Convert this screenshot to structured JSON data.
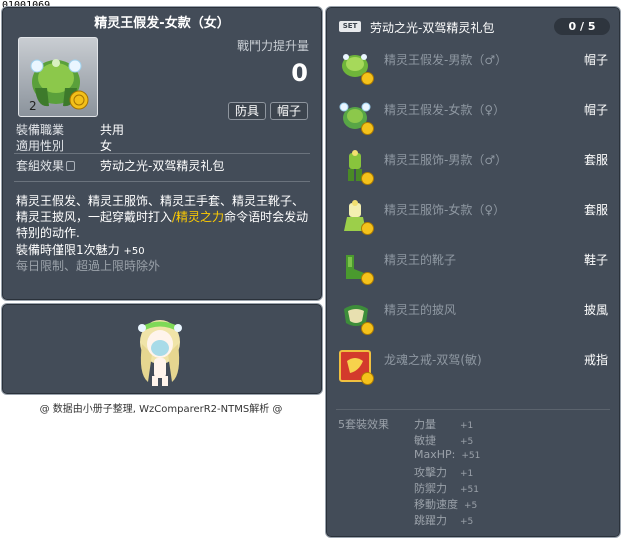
{
  "item_id": "01001069",
  "item": {
    "name": "精灵王假发-女款（女）",
    "power_label": "戰鬥力提升量",
    "power_value": "0",
    "tags": [
      "防具",
      "帽子"
    ],
    "stats": [
      {
        "key": "裝備職業",
        "value": "共用"
      },
      {
        "key": "適用性別",
        "value": "女"
      }
    ],
    "set_effect_label": "套組效果",
    "set_effect_value": "劳动之光-双驾精灵礼包",
    "desc_part1": "精灵王假发、精灵王服饰、精灵王手套、精灵王靴子、精灵王披风，一起穿戴时打入",
    "desc_highlight": "/精灵之力",
    "desc_part2": "命令语时会发动特别的动作.",
    "limit_label": "裝備時僅限1次魅力",
    "limit_value": "+50",
    "daily_note": "每日限制、超過上限時除外"
  },
  "credit": "@ 数据由小册子整理, WzComparerR2-NTMS解析 @",
  "set": {
    "badge": "SET",
    "name": "劳动之光-双驾精灵礼包",
    "count": "0 / 5",
    "items": [
      {
        "name": "精灵王假发-男款（♂）",
        "type": "帽子",
        "icon": "hat-icon",
        "color": "#6fb53a"
      },
      {
        "name": "精灵王假发-女款（♀）",
        "type": "帽子",
        "icon": "hat-icon",
        "color": "#58a646"
      },
      {
        "name": "精灵王服饰-男款（♂）",
        "type": "套服",
        "icon": "outfit-icon",
        "color": "#88c43c"
      },
      {
        "name": "精灵王服饰-女款（♀）",
        "type": "套服",
        "icon": "outfit-icon",
        "color": "#9ccf4a"
      },
      {
        "name": "精灵王的靴子",
        "type": "鞋子",
        "icon": "shoes-icon",
        "color": "#4a9a2e"
      },
      {
        "name": "精灵王的披风",
        "type": "披風",
        "icon": "cape-icon",
        "color": "#3d8d3a"
      },
      {
        "name": "龙魂之戒-双驾(敏)",
        "type": "戒指",
        "icon": "ring-icon",
        "color": "#e04030"
      }
    ],
    "effects_title": "5套裝效果",
    "effects": [
      {
        "key": "力量",
        "value": "+1"
      },
      {
        "key": "敏捷",
        "value": "+5"
      },
      {
        "key": "MaxHP:",
        "value": "+51"
      },
      {
        "key": "攻擊力",
        "value": "+1"
      },
      {
        "key": "防禦力",
        "value": "+51"
      },
      {
        "key": "移動速度",
        "value": "+5"
      },
      {
        "key": "跳躍力",
        "value": "+5"
      }
    ]
  }
}
